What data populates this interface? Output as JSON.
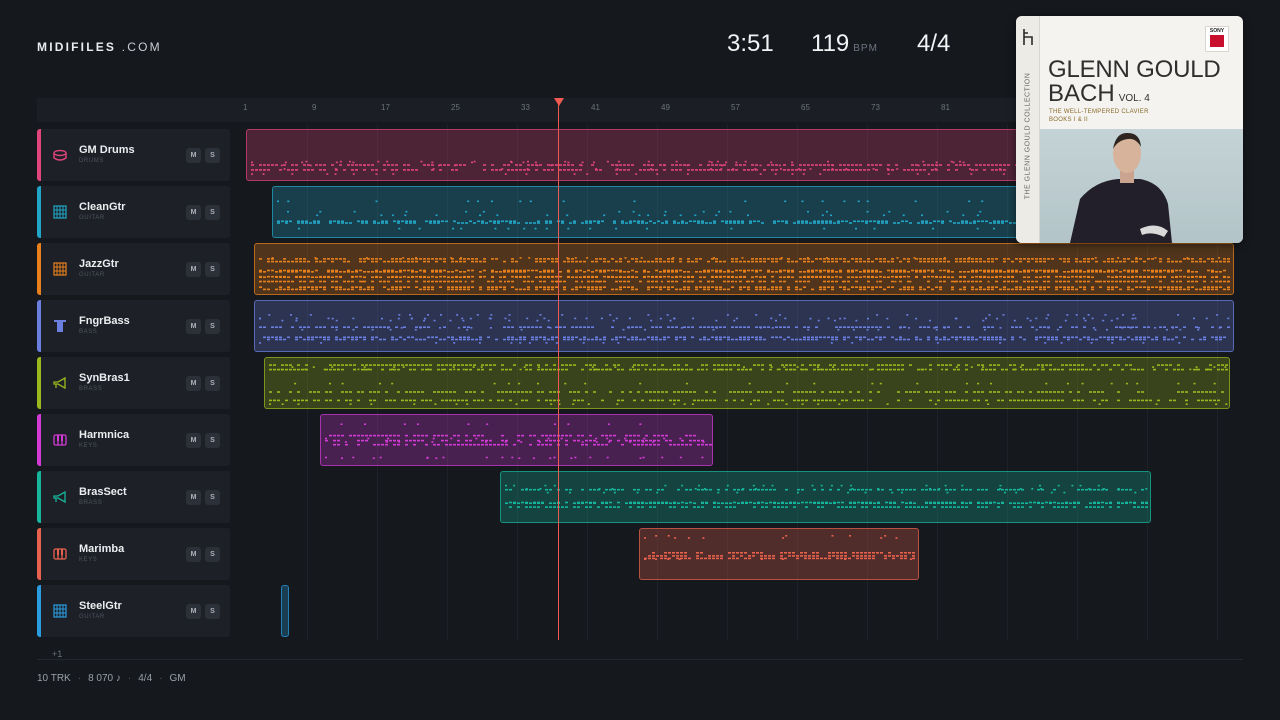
{
  "brand": {
    "name": "MIDIFILES",
    "suffix": ".COM"
  },
  "transport": {
    "time": "3:51",
    "bpm": "119",
    "bpm_unit": "BPM",
    "time_signature": "4/4"
  },
  "ruler": {
    "marks": [
      "1",
      "9",
      "17",
      "25",
      "33",
      "41",
      "49",
      "57",
      "65",
      "73",
      "81"
    ]
  },
  "playhead": {
    "bar": 38
  },
  "tracks": [
    {
      "name": "GM Drums",
      "category": "DRUMS",
      "color": "#e0457b",
      "icon": "drum-icon",
      "mute": "M",
      "solo": "S"
    },
    {
      "name": "CleanGtr",
      "category": "GUITAR",
      "color": "#22a6c7",
      "icon": "guitar-icon",
      "mute": "M",
      "solo": "S"
    },
    {
      "name": "JazzGtr",
      "category": "GUITAR",
      "color": "#e8801c",
      "icon": "guitar-icon",
      "mute": "M",
      "solo": "S"
    },
    {
      "name": "FngrBass",
      "category": "BASS",
      "color": "#6a7fe0",
      "icon": "bass-icon",
      "mute": "M",
      "solo": "S"
    },
    {
      "name": "SynBras1",
      "category": "BRASS",
      "color": "#9bb81e",
      "icon": "horn-icon",
      "mute": "M",
      "solo": "S"
    },
    {
      "name": "Harmnica",
      "category": "KEYS",
      "color": "#d23bd6",
      "icon": "keys-icon",
      "mute": "M",
      "solo": "S"
    },
    {
      "name": "BrasSect",
      "category": "BRASS",
      "color": "#17b59c",
      "icon": "horn-icon",
      "mute": "M",
      "solo": "S"
    },
    {
      "name": "Marimba",
      "category": "KEYS",
      "color": "#e8624e",
      "icon": "keys-icon",
      "mute": "M",
      "solo": "S"
    },
    {
      "name": "SteelGtr",
      "category": "GUITAR",
      "color": "#2a9de0",
      "icon": "guitar-icon",
      "mute": "M",
      "solo": "S"
    }
  ],
  "more_tracks": "+1",
  "footer": {
    "tracks": "10 TRK",
    "notes": "8 070 ♪",
    "time_signature": "4/4",
    "standard": "GM"
  },
  "album": {
    "label": "SONY",
    "label_sub": "CLASSICAL",
    "title_line1": "GLENN GOULD",
    "title_line2": "BACH",
    "volume": "VOL. 4",
    "subtitle_line1": "THE WELL-TEMPERED CLAVIER",
    "subtitle_line2": "BOOKS I & II",
    "spine": "THE GLENN GOULD COLLECTION"
  }
}
